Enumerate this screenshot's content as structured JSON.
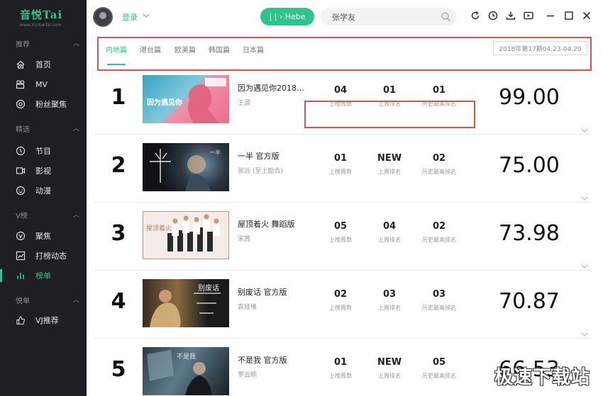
{
  "app": {
    "logo_text": "音悦Tai",
    "logo_url": "www.YinYueTai.com"
  },
  "sidebar": {
    "sections": [
      {
        "label": "推荐",
        "items": [
          {
            "label": "首页",
            "icon": "home-icon"
          },
          {
            "label": "MV",
            "icon": "mv-icon"
          },
          {
            "label": "粉丝聚焦",
            "icon": "fan-focus-icon"
          }
        ]
      },
      {
        "label": "精选",
        "items": [
          {
            "label": "节目",
            "icon": "program-icon"
          },
          {
            "label": "影视",
            "icon": "film-icon"
          },
          {
            "label": "动漫",
            "icon": "anime-icon"
          }
        ]
      },
      {
        "label": "V榜",
        "items": [
          {
            "label": "聚焦",
            "icon": "v-focus-icon"
          },
          {
            "label": "打榜动态",
            "icon": "trend-icon"
          },
          {
            "label": "榜单",
            "icon": "chart-bars-icon",
            "active": true
          }
        ]
      },
      {
        "label": "悦单",
        "items": [
          {
            "label": "VJ推荐",
            "icon": "thumb-up-icon"
          }
        ]
      }
    ]
  },
  "topbar": {
    "login_label": "登录",
    "now_playing": "| | › Hebe",
    "search_value": "张学友"
  },
  "tabs": {
    "items": [
      "内地篇",
      "港台篇",
      "欧美篇",
      "韩国篇",
      "日本篇"
    ],
    "active": "内地篇",
    "week_label": "2018年第17期04.23-04.29"
  },
  "stat_labels": {
    "weeks": "上榜周数",
    "last_week": "上周排名",
    "best": "历史最高排名"
  },
  "entries": [
    {
      "rank": "1",
      "title": "因为遇见你2018…",
      "artist": "王源",
      "weeks": "04",
      "last_week": "01",
      "best": "01",
      "score": "99.00"
    },
    {
      "rank": "2",
      "title": "一半 官方版",
      "artist": "张远 (至上励合)",
      "weeks": "01",
      "last_week": "NEW",
      "best": "02",
      "score": "75.00"
    },
    {
      "rank": "3",
      "title": "屋顶着火 舞蹈版",
      "artist": "宋茜",
      "weeks": "05",
      "last_week": "04",
      "best": "02",
      "score": "73.98"
    },
    {
      "rank": "4",
      "title": "别废话 官方版",
      "artist": "袁娅维",
      "weeks": "02",
      "last_week": "03",
      "best": "03",
      "score": "70.87"
    },
    {
      "rank": "5",
      "title": "不是我 官方版",
      "artist": "罗云熙",
      "weeks": "01",
      "last_week": "NEW",
      "best": "05",
      "score": "66.53"
    }
  ],
  "covers": [
    {
      "text": "因为遇见你"
    },
    {
      "text": "一半"
    },
    {
      "text": "屋顶着火"
    },
    {
      "text": "别废话"
    },
    {
      "text": "不是我"
    }
  ],
  "watermark": "极速下载站",
  "colors": {
    "accent": "#2fc48b",
    "highlight_border": "#d9534f",
    "sidebar_bg": "#1e1f22"
  }
}
